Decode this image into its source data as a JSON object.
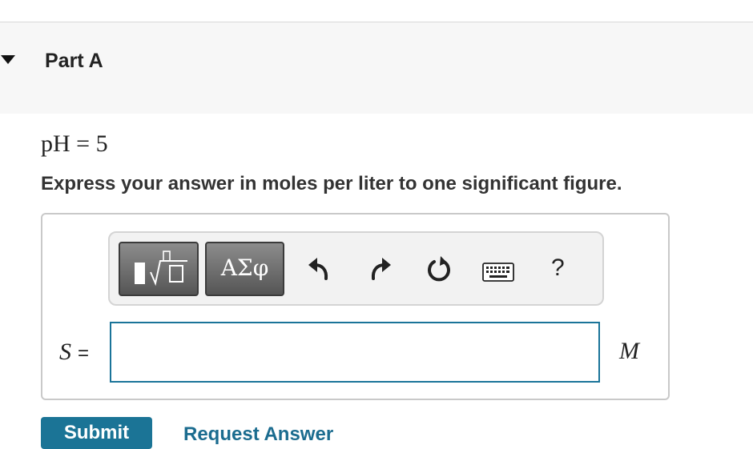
{
  "part": {
    "title": "Part A",
    "given": "pH = 5",
    "instruction": "Express your answer in moles per liter to one significant figure."
  },
  "toolbar": {
    "templates_icon": "templates-icon",
    "symbols_label": "ΑΣφ",
    "undo_icon": "undo-icon",
    "redo_icon": "redo-icon",
    "reset_icon": "reset-icon",
    "keyboard_icon": "keyboard-icon",
    "help_label": "?"
  },
  "answer": {
    "variable": "S",
    "equals": "=",
    "value": "",
    "unit": "M"
  },
  "actions": {
    "submit_label": "Submit",
    "request_label": "Request Answer"
  },
  "colors": {
    "accent": "#1b7496",
    "header_bg": "#f7f7f7",
    "input_border": "#1a7499"
  }
}
